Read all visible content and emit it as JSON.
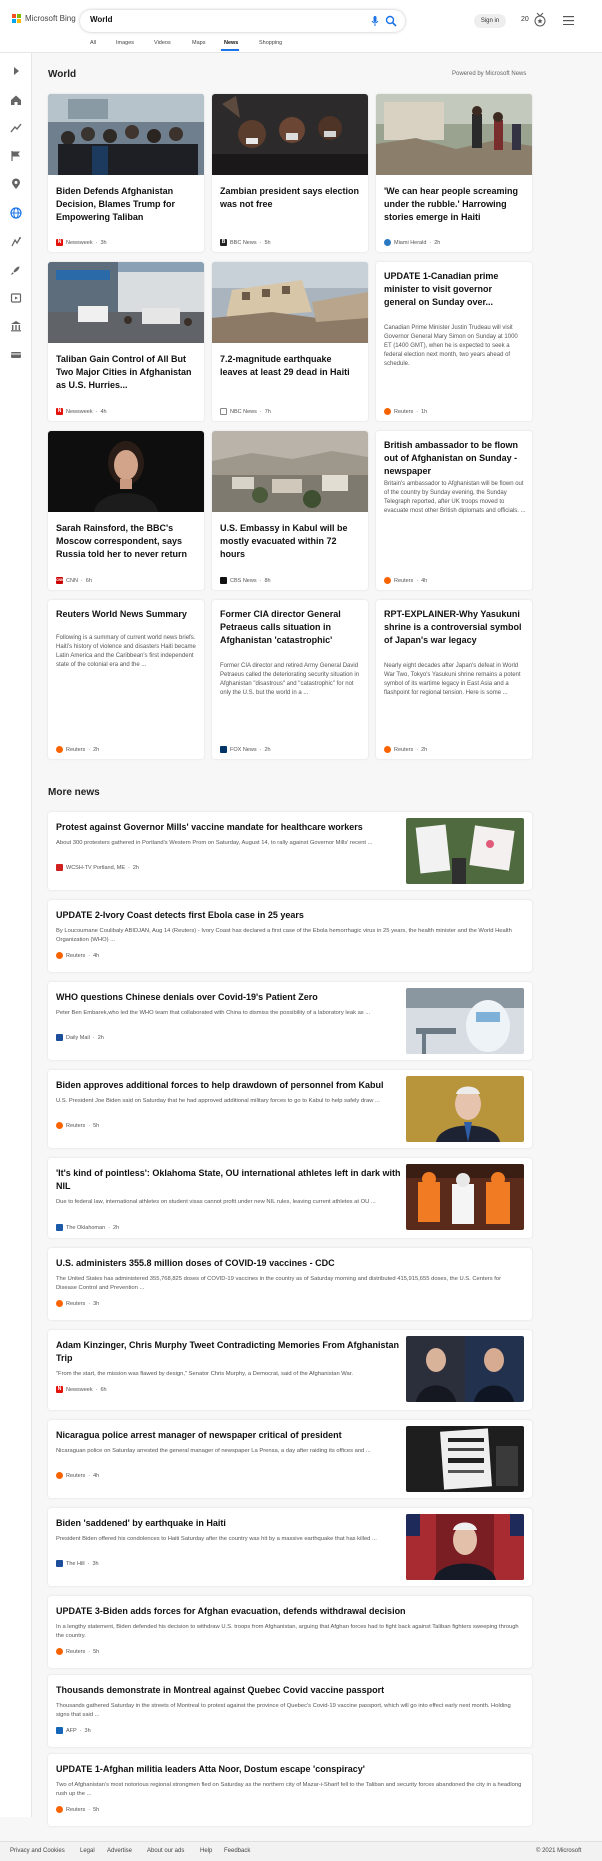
{
  "brand": {
    "name": "Microsoft Bing"
  },
  "search": {
    "query": "World"
  },
  "header": {
    "signin": "Sign in",
    "points": "20"
  },
  "tabs": [
    "All",
    "Images",
    "Videos",
    "Maps",
    "News",
    "Shopping"
  ],
  "active_tab": "News",
  "section": {
    "title": "World",
    "powered": "Powered by Microsoft News"
  },
  "grid": [
    {
      "title": "Biden Defends Afghanistan Decision, Blames Trump for Empowering Taliban",
      "desc": "",
      "source": "Newsweek",
      "time": "3h"
    },
    {
      "title": "Zambian president says election was not free",
      "desc": "",
      "source": "BBC News",
      "time": "5h"
    },
    {
      "title": "'We can hear people screaming under the rubble.' Harrowing stories emerge in Haiti",
      "desc": "",
      "source": "Miami Herald",
      "time": "2h"
    },
    {
      "title": "Taliban Gain Control of All But Two Major Cities in Afghanistan as U.S. Hurries...",
      "desc": "",
      "source": "Newsweek",
      "time": "4h"
    },
    {
      "title": "7.2-magnitude earthquake leaves at least 29 dead in Haiti",
      "desc": "",
      "source": "NBC News",
      "time": "7h"
    },
    {
      "title": "UPDATE 1-Canadian prime minister to visit governor general on Sunday over...",
      "desc": "Canadian Prime Minister Justin Trudeau will visit Governor General Mary Simon on Sunday at 1000 ET (1400 GMT), when he is expected to seek a federal election next month, two years ahead of schedule.",
      "source": "Reuters",
      "time": "1h"
    },
    {
      "title": "Sarah Rainsford, the BBC's Moscow correspondent, says Russia told her to never return",
      "desc": "",
      "source": "CNN",
      "time": "6h"
    },
    {
      "title": "U.S. Embassy in Kabul will be mostly evacuated within 72 hours",
      "desc": "",
      "source": "CBS News",
      "time": "8h"
    },
    {
      "title": "British ambassador to be flown out of Afghanistan on Sunday - newspaper",
      "desc": "Britain's ambassador to Afghanistan will be flown out of the country by Sunday evening, the Sunday Telegraph reported, after UK troops moved to evacuate most other British diplomats and officials. ...",
      "source": "Reuters",
      "time": "4h"
    },
    {
      "title": "Reuters World News Summary",
      "desc": "Following is a summary of current world news briefs. Haiti's history of violence and disasters Haiti became Latin America and the Caribbean's first independent state of the colonial era and the ...",
      "source": "Reuters",
      "time": "2h"
    },
    {
      "title": "Former CIA director General Petraeus calls situation in Afghanistan 'catastrophic'",
      "desc": "Former CIA director and retired Army General David Petraeus called the deteriorating security situation in Afghanistan \"disastrous\" and \"catastrophic\" for not only the U.S. but the world in a ...",
      "source": "FOX News",
      "time": "2h"
    },
    {
      "title": "RPT-EXPLAINER-Why Yasukuni shrine is a controversial symbol of Japan's war legacy",
      "desc": "Nearly eight decades after Japan's defeat in World War Two, Tokyo's Yasukuni shrine remains a potent symbol of its wartime legacy in East Asia and a flashpoint for regional tension. Here is some ...",
      "source": "Reuters",
      "time": "2h"
    }
  ],
  "more_news": {
    "title": "More news",
    "items": [
      {
        "title": "Protest against Governor Mills' vaccine mandate for healthcare workers",
        "desc": "About 300 protesters gathered in Portland's Western Prom on Saturday, August 14, to rally against Governor Mills' recent ...",
        "source": "WCSH-TV Portland, ME",
        "time": "2h"
      },
      {
        "title": "UPDATE 2-Ivory Coast detects first Ebola case in 25 years",
        "desc": "By Loucoumane Coulibaly ABIDJAN, Aug 14 (Reuters) - Ivory Coast has declared a first case of the Ebola hemorrhagic virus in 25 years, the health minister and the World Health Organization (WHO) ...",
        "source": "Reuters",
        "time": "4h"
      },
      {
        "title": "WHO questions Chinese denials over Covid-19's Patient Zero",
        "desc": "Peter Ben Embarek,who led the WHO team that collaborated with China to dismiss the possibility of a laboratory leak as ...",
        "source": "Daily Mail",
        "time": "2h"
      },
      {
        "title": "Biden approves additional forces to help drawdown of personnel from Kabul",
        "desc": "U.S. President Joe Biden said on Saturday that he had approved additional military forces to go to Kabul to help safely draw ...",
        "source": "Reuters",
        "time": "5h"
      },
      {
        "title": "'It's kind of pointless': Oklahoma State, OU international athletes left in dark with NIL",
        "desc": "Due to federal law, international athletes on student visas cannot profit under new NIL rules, leaving current athletes at OU ...",
        "source": "The Oklahoman",
        "time": "2h"
      },
      {
        "title": "U.S. administers 355.8 million doses of COVID-19 vaccines - CDC",
        "desc": "The United States has administered 355,768,825 doses of COVID-19 vaccines in the country as of Saturday morning and distributed 415,915,655 doses, the U.S. Centers for Disease Control and Prevention ...",
        "source": "Reuters",
        "time": "3h"
      },
      {
        "title": "Adam Kinzinger, Chris Murphy Tweet Contradicting Memories From Afghanistan Trip",
        "desc": "\"From the start, the mission was flawed by design,\" Senator Chris Murphy, a Democrat, said of the Afghanistan War.",
        "source": "Newsweek",
        "time": "6h"
      },
      {
        "title": "Nicaragua police arrest manager of newspaper critical of president",
        "desc": "Nicaraguan police on Saturday arrested the general manager of newspaper La Prensa, a day after raiding its offices and ...",
        "source": "Reuters",
        "time": "4h"
      },
      {
        "title": "Biden 'saddened' by earthquake in Haiti",
        "desc": "President Biden offered his condolences to Haiti Saturday after the country was hit by a massive earthquake that has killed ...",
        "source": "The Hill",
        "time": "3h"
      },
      {
        "title": "UPDATE 3-Biden adds forces for Afghan evacuation, defends withdrawal decision",
        "desc": "In a lengthy statement, Biden defended his decision to withdraw U.S. troops from Afghanistan, arguing that Afghan forces had to fight back against Taliban fighters sweeping through the country.",
        "source": "Reuters",
        "time": "5h"
      },
      {
        "title": "Thousands demonstrate in Montreal against Quebec Covid vaccine passport",
        "desc": "Thousands gathered Saturday in the streets of Montreal to protest against the province of Quebec's Covid-19 vaccine passport, which will go into effect early next month. Holding signs that said ...",
        "source": "AFP",
        "time": "3h"
      },
      {
        "title": "UPDATE 1-Afghan militia leaders Atta Noor, Dostum escape 'conspiracy'",
        "desc": "Two of Afghanistan's most notorious regional strongmen fled on Saturday as the northern city of Mazar-i-Sharif fell to the Taliban and security forces abandoned the city in a headlong rush up the ...",
        "source": "Reuters",
        "time": "5h"
      }
    ]
  },
  "footer": {
    "links": [
      "Privacy and Cookies",
      "Legal",
      "Advertise",
      "About our ads",
      "Help",
      "Feedback"
    ],
    "copyright": "© 2021 Microsoft"
  },
  "colors": {
    "accent": "#1a73e8",
    "reuters": "#fa6400",
    "newsweek": "#e3120b",
    "cnn": "#cc0000"
  }
}
